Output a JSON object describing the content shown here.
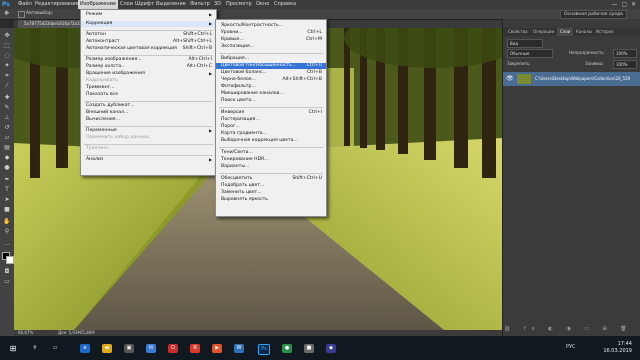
{
  "app": {
    "logo": "Ps"
  },
  "menubar": [
    "Файл",
    "Редактирование",
    "Изображение",
    "Слои",
    "Шрифт",
    "Выделение",
    "Фильтр",
    "3D",
    "Просмотр",
    "Окно",
    "Справка"
  ],
  "options": {
    "autoselect": "Автовыбор:",
    "workspace": "Основная рабочая среда"
  },
  "document_tab": "5a78775423dae1616a72a1b5...",
  "status": {
    "zoom": "66,67%",
    "doc": "Док: 5,93M/5,86M"
  },
  "image_menu": {
    "items": [
      {
        "label": "Режим",
        "shortcut": "",
        "arrow": true
      },
      {
        "label": "Коррекция",
        "shortcut": "",
        "arrow": true,
        "highlight": true
      },
      {
        "label": "Автотон",
        "shortcut": "Shift+Ctrl+L"
      },
      {
        "label": "Автоконтраст",
        "shortcut": "Alt+Shift+Ctrl+L"
      },
      {
        "label": "Автоматическая цветовая коррекция",
        "shortcut": "Shift+Ctrl+B"
      },
      {
        "label": "Размер изображения...",
        "shortcut": "Alt+Ctrl+I"
      },
      {
        "label": "Размер холста...",
        "shortcut": "Alt+Ctrl+C"
      },
      {
        "label": "Вращение изображения",
        "shortcut": "",
        "arrow": true
      },
      {
        "label": "Кадрировать",
        "shortcut": "",
        "disabled": true
      },
      {
        "label": "Тримминг...",
        "shortcut": ""
      },
      {
        "label": "Показать все",
        "shortcut": ""
      },
      {
        "label": "Создать дубликат...",
        "shortcut": ""
      },
      {
        "label": "Внешний канал...",
        "shortcut": ""
      },
      {
        "label": "Вычисления...",
        "shortcut": ""
      },
      {
        "label": "Переменные",
        "shortcut": "",
        "arrow": true
      },
      {
        "label": "Применить набор данных...",
        "shortcut": "",
        "disabled": true
      },
      {
        "label": "Треппинг...",
        "shortcut": "",
        "disabled": true
      },
      {
        "label": "Анализ",
        "shortcut": "",
        "arrow": true
      }
    ]
  },
  "adjust_menu": {
    "items": [
      {
        "label": "Яркость/Контрастность...",
        "shortcut": ""
      },
      {
        "label": "Уровни...",
        "shortcut": "Ctrl+L"
      },
      {
        "label": "Кривые...",
        "shortcut": "Ctrl+M"
      },
      {
        "label": "Экспозиция...",
        "shortcut": ""
      },
      {
        "label": "Вибрация...",
        "shortcut": ""
      },
      {
        "label": "Цветовой тон/Насыщенность...",
        "shortcut": "Ctrl+U",
        "selected": true
      },
      {
        "label": "Цветовой баланс...",
        "shortcut": "Ctrl+B"
      },
      {
        "label": "Черно-белое...",
        "shortcut": "Alt+Shift+Ctrl+B"
      },
      {
        "label": "Фотофильтр...",
        "shortcut": ""
      },
      {
        "label": "Микширование каналов...",
        "shortcut": ""
      },
      {
        "label": "Поиск цвета...",
        "shortcut": ""
      },
      {
        "label": "Инверсия",
        "shortcut": "Ctrl+I"
      },
      {
        "label": "Постеризация...",
        "shortcut": ""
      },
      {
        "label": "Порог...",
        "shortcut": ""
      },
      {
        "label": "Карта градиента...",
        "shortcut": ""
      },
      {
        "label": "Выборочная коррекция цвета...",
        "shortcut": ""
      },
      {
        "label": "Тени/Света...",
        "shortcut": ""
      },
      {
        "label": "Тонирование HDR...",
        "shortcut": ""
      },
      {
        "label": "Варианты...",
        "shortcut": ""
      },
      {
        "label": "Обесцветить",
        "shortcut": "Shift+Ctrl+U"
      },
      {
        "label": "Подобрать цвет...",
        "shortcut": ""
      },
      {
        "label": "Заменить цвет...",
        "shortcut": ""
      },
      {
        "label": "Выровнять яркость",
        "shortcut": ""
      }
    ]
  },
  "panels": {
    "tabs": [
      "Свойства",
      "Операции",
      "Слои",
      "Каналы",
      "История"
    ],
    "kind": "Вид",
    "mode": "Обычные",
    "opacity_label": "Непрозрачность:",
    "opacity_value": "100%",
    "lock_label": "Закрепить:",
    "fill_label": "Заливка:",
    "fill_value": "100%",
    "layer_name": "C:\\Users\\Desktop\\Wallpapers\\Collection\\20_559"
  },
  "taskbar": {
    "time": "17:44",
    "date": "16.03.2019",
    "lang": "РУС"
  },
  "colors": {
    "accent": "#3574d5",
    "menu_bg": "#f0f0f0",
    "layer_selected": "#4a6c93"
  }
}
